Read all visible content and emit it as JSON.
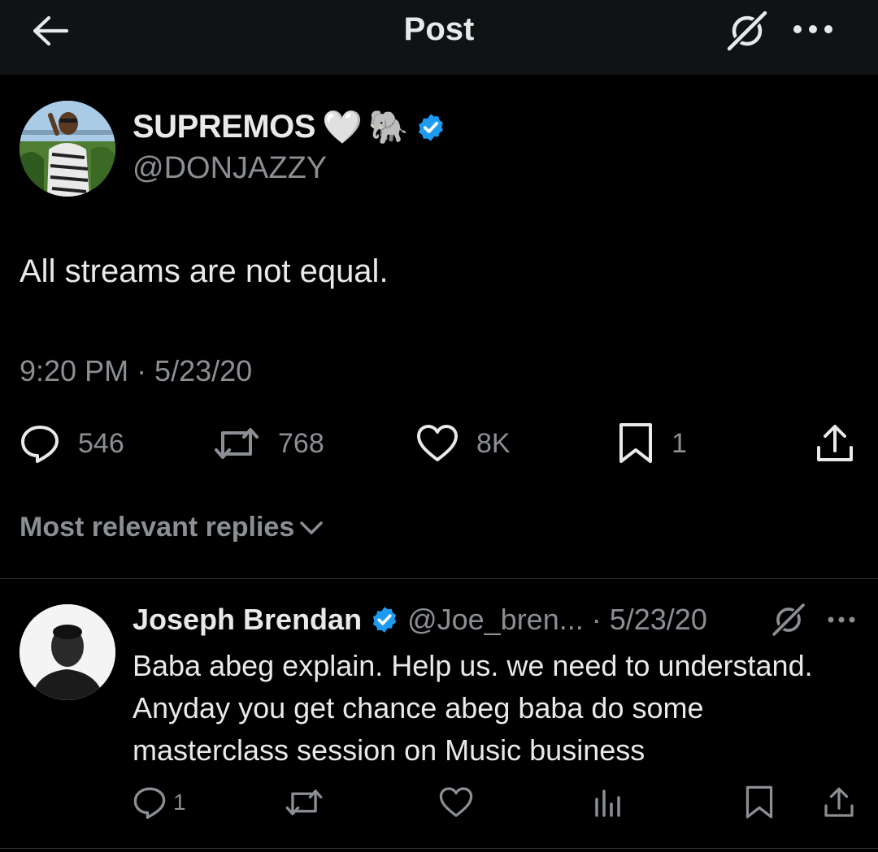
{
  "header": {
    "title": "Post"
  },
  "post": {
    "author_name": "SUPREMOS",
    "author_emoji_1": "🤍",
    "author_emoji_2": "🐘",
    "author_handle": "@DONJAZZY",
    "verified": true,
    "text": "All streams are not equal.",
    "timestamp": "9:20 PM · 5/23/20",
    "stats": {
      "replies": "546",
      "reposts": "768",
      "likes": "8K",
      "bookmarks": "1"
    }
  },
  "replies_section": {
    "label": "Most relevant replies"
  },
  "reply": {
    "author_name": "Joseph Brendan",
    "verified": true,
    "meta": "@Joe_bren... · 5/23/20",
    "text": "Baba abeg explain. Help us. we need to understand. Anyday you get chance abeg baba do some masterclass session on Music business",
    "reply_count": "1"
  },
  "colors": {
    "background": "#000000",
    "topbar": "#111213",
    "text_primary": "#e7e9ea",
    "text_secondary": "#8b8f94",
    "verified_blue": "#1d9bf0",
    "divider": "#2f3336"
  }
}
